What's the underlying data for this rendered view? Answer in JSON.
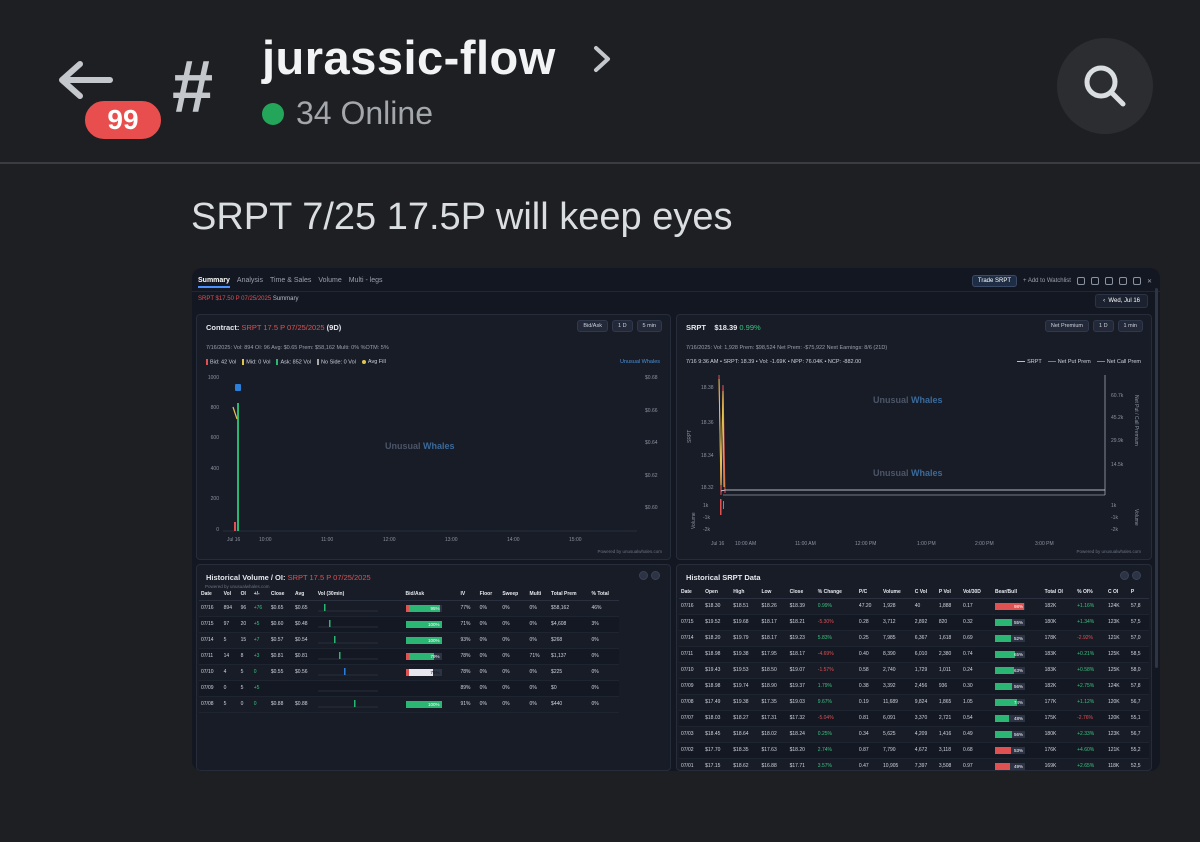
{
  "channel": {
    "back_label": "Back",
    "unread_count": "99",
    "name": "jurassic-flow",
    "online": "34 Online"
  },
  "message": {
    "text": "SRPT 7/25 17.5P will keep eyes"
  },
  "screenshot": {
    "tabs": [
      "Summary",
      "Analysis",
      "Time & Sales",
      "Volume",
      "Multi - legs"
    ],
    "trade_btn": "Trade SRPT",
    "watchlist": "+ Add to Watchlist",
    "sub_red": "SRPT $17.50 P 07/25/2025",
    "sub_label": "Summary",
    "date_btn": "Wed, Jul 16",
    "contract": {
      "title_prefix": "Contract:",
      "title_red": "SRPT 17.5 P 07/25/2025",
      "title_days": "(9D)",
      "ctrl1": "Bid/Ask",
      "ctrl2": "1 D",
      "ctrl3": "5 min",
      "stats": "7/16/2025:   Vol: 894   OI: 96   Avg: $0.65   Prem: $58,162   Multi: 0%   %OTM: 5%",
      "legend": [
        "Bid: 42 Vol",
        "Mid: 0 Vol",
        "Ask: 852 Vol",
        "No Side: 0 Vol",
        "Avg Fill"
      ],
      "brand": "Unusual Whales",
      "watermark_a": "Unusual",
      "watermark_b": "Whales",
      "powered": "Powered by unusualwhales.com",
      "y_left": [
        "1000",
        "800",
        "600",
        "400",
        "200",
        "0"
      ],
      "y_right": [
        "$0.68",
        "$0.66",
        "$0.64",
        "$0.62",
        "$0.60"
      ],
      "x_ticks": [
        "Jul 16",
        "10:00",
        "11:00",
        "12:00",
        "13:00",
        "14:00",
        "15:00"
      ]
    },
    "stock": {
      "ticker": "SRPT",
      "price": "$18.39",
      "change": "0.99%",
      "ctrl1": "Net Premium",
      "ctrl2": "1 D",
      "ctrl3": "1 min",
      "stats": "7/16/2025:   Vol: 1,928   Prem: $98,524   Net Prem: -$75,922   Next Earnings: 8/6 (21D)",
      "subline": "7/16 9:36 AM • SRPT: 18.39 • Vol: -1.69K • NPP: 76.04K • NCP: -882.00",
      "legend": [
        "SRPT",
        "Net Put Prem",
        "Net Call Prem"
      ],
      "watermark_a": "Unusual",
      "watermark_b": "Whales",
      "powered": "Powered by unusualwhales.com",
      "y_left": [
        "18.38",
        "18.36",
        "18.34",
        "18.32"
      ],
      "y_left_label": "SRPT",
      "y_vol": [
        "1k",
        "-1k",
        "-2k"
      ],
      "y_vol_label": "Volume",
      "y_right": [
        "60.7k",
        "45.2k",
        "29.9k",
        "14.5k"
      ],
      "y_right_label": "Net Put / Call Premium",
      "y_right_vol": [
        "1k",
        "-1k",
        "-2k"
      ],
      "x_ticks": [
        "Jul 16",
        "10:00 AM",
        "11:00 AM",
        "12:00 PM",
        "1:00 PM",
        "2:00 PM",
        "3:00 PM"
      ]
    },
    "hist_oi": {
      "title": "Historical Volume / OI:",
      "title_red": "SRPT 17.5 P 07/25/2025",
      "powered": "Powered by unusualwhales.com",
      "headers": [
        "Date",
        "Vol",
        "OI",
        "+/-",
        "Close",
        "Avg",
        "Vol (30min)",
        "Bid/Ask",
        "IV",
        "Floor",
        "Sweep",
        "Multi",
        "Total Prem",
        "% Total"
      ],
      "rows": [
        [
          "07/16",
          "894",
          "96",
          "+76",
          "$0.65",
          "$0.65",
          "95%",
          "77%",
          "0%",
          "0%",
          "0%",
          "$58,162",
          "46%"
        ],
        [
          "07/15",
          "97",
          "20",
          "+5",
          "$0.60",
          "$0.48",
          "100%",
          "71%",
          "0%",
          "0%",
          "0%",
          "$4,608",
          "3%"
        ],
        [
          "07/14",
          "5",
          "15",
          "+7",
          "$0.57",
          "$0.54",
          "100%",
          "93%",
          "0%",
          "0%",
          "0%",
          "$268",
          "0%"
        ],
        [
          "07/11",
          "14",
          "8",
          "+3",
          "$0.81",
          "$0.81",
          "79%",
          "78%",
          "0%",
          "0%",
          "71%",
          "$1,137",
          "0%"
        ],
        [
          "07/10",
          "4",
          "5",
          "0",
          "$0.55",
          "$0.56",
          "75%",
          "78%",
          "0%",
          "0%",
          "0%",
          "$225",
          "0%"
        ],
        [
          "07/09",
          "0",
          "5",
          "+5",
          "",
          "",
          "",
          "89%",
          "0%",
          "0%",
          "0%",
          "$0",
          "0%"
        ],
        [
          "07/08",
          "5",
          "0",
          "0",
          "$0.88",
          "$0.88",
          "100%",
          "91%",
          "0%",
          "0%",
          "0%",
          "$440",
          "0%"
        ]
      ],
      "bidask": [
        0.95,
        1.0,
        1.0,
        0.79,
        0.75,
        0,
        1.0
      ]
    },
    "hist_srpt": {
      "title": "Historical SRPT Data",
      "headers": [
        "Date",
        "Open",
        "High",
        "Low",
        "Close",
        "% Change",
        "P/C",
        "Volume",
        "C Vol",
        "P Vol",
        "Vol/30D",
        "Bear/Bull",
        "Total OI",
        "% OI%",
        "C OI",
        "P"
      ],
      "rows": [
        [
          "07/16",
          "$18.30",
          "$18.51",
          "$18.26",
          "$18.39",
          "0.99%",
          "47.20",
          "1,928",
          "40",
          "1,888",
          "0.17",
          "98%",
          "182K",
          "+1.16%",
          "124K",
          "57,8"
        ],
        [
          "07/15",
          "$19.52",
          "$19.68",
          "$18.17",
          "$18.21",
          "-5.30%",
          "0.28",
          "3,712",
          "2,892",
          "820",
          "0.32",
          "55%",
          "180K",
          "+1.34%",
          "123K",
          "57,5"
        ],
        [
          "07/14",
          "$18.20",
          "$19.79",
          "$18.17",
          "$19.23",
          "5.83%",
          "0.25",
          "7,985",
          "6,367",
          "1,618",
          "0.69",
          "52%",
          "178K",
          "-2.92%",
          "121K",
          "57,0"
        ],
        [
          "07/11",
          "$18.98",
          "$19.38",
          "$17.95",
          "$18.17",
          "-4.69%",
          "0.40",
          "8,390",
          "6,010",
          "2,380",
          "0.74",
          "65%",
          "183K",
          "+0.21%",
          "125K",
          "58,5"
        ],
        [
          "07/10",
          "$19.43",
          "$19.53",
          "$18.50",
          "$19.07",
          "-1.57%",
          "0.58",
          "2,740",
          "1,729",
          "1,011",
          "0.24",
          "63%",
          "183K",
          "+0.58%",
          "125K",
          "58,0"
        ],
        [
          "07/09",
          "$18.98",
          "$19.74",
          "$18.90",
          "$19.37",
          "1.79%",
          "0.38",
          "3,392",
          "2,456",
          "936",
          "0.30",
          "56%",
          "182K",
          "+2.75%",
          "124K",
          "57,8"
        ],
        [
          "07/08",
          "$17.49",
          "$19.38",
          "$17.35",
          "$19.03",
          "9.67%",
          "0.19",
          "11,689",
          "9,824",
          "1,865",
          "1.05",
          "74%",
          "177K",
          "+1.12%",
          "120K",
          "56,7"
        ],
        [
          "07/07",
          "$18.03",
          "$18.27",
          "$17.31",
          "$17.32",
          "-5.04%",
          "0.81",
          "6,091",
          "3,370",
          "2,721",
          "0.54",
          "48%",
          "175K",
          "-2.76%",
          "120K",
          "55,1"
        ],
        [
          "07/03",
          "$18.45",
          "$18.64",
          "$18.02",
          "$18.24",
          "0.25%",
          "0.34",
          "5,625",
          "4,209",
          "1,416",
          "0.49",
          "56%",
          "180K",
          "+2.33%",
          "123K",
          "56,7"
        ],
        [
          "07/02",
          "$17.70",
          "$18.35",
          "$17.63",
          "$18.20",
          "2.74%",
          "0.87",
          "7,790",
          "4,672",
          "3,118",
          "0.68",
          "53%",
          "176K",
          "+4.60%",
          "121K",
          "55,2"
        ],
        [
          "07/01",
          "$17.15",
          "$18.62",
          "$16.88",
          "$17.71",
          "3.57%",
          "0.47",
          "10,905",
          "7,397",
          "3,508",
          "0.97",
          "49%",
          "169K",
          "+2.65%",
          "118K",
          "52,5"
        ]
      ],
      "bearbull": [
        0.98,
        0.55,
        0.52,
        0.65,
        0.63,
        0.56,
        0.74,
        0.48,
        0.56,
        0.53,
        0.49
      ],
      "bullish": [
        false,
        true,
        true,
        true,
        true,
        true,
        true,
        true,
        true,
        false,
        false
      ]
    }
  }
}
